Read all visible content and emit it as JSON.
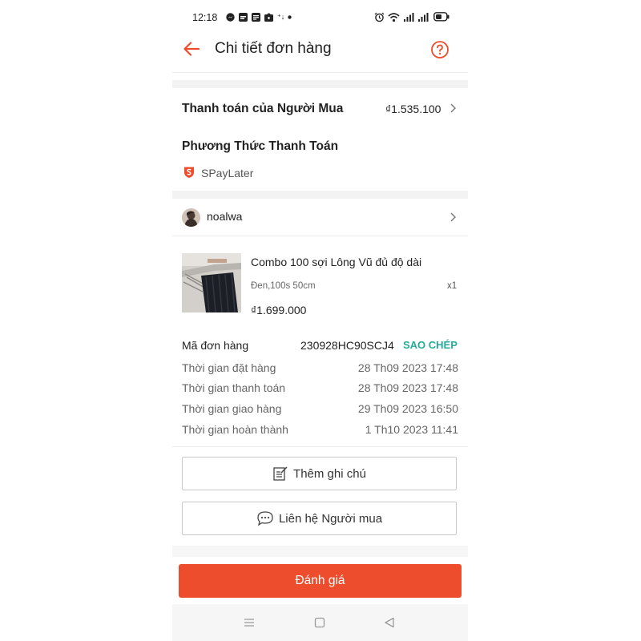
{
  "status_bar": {
    "time": "12:18",
    "icons": [
      "messenger-icon",
      "facebook-icon",
      "facebook-icon",
      "shopee-icon",
      "dot-icon",
      "alarm-icon",
      "wifi-icon",
      "signal-icon",
      "signal-icon",
      "battery-icon"
    ]
  },
  "header": {
    "title": "Chi tiết đơn hàng",
    "back_icon": "arrow-left-icon",
    "help_icon": "question-circle-icon"
  },
  "payment": {
    "buyer_payment_label": "Thanh toán của Người Mua",
    "buyer_payment_amount": "₫1.535.100",
    "method_title": "Phương Thức Thanh Toán",
    "method_name": "SPayLater"
  },
  "buyer": {
    "name": "noalwa"
  },
  "product": {
    "name": "Combo 100 sợi Lông Vũ đủ độ dài",
    "variant": "Đen,100s 50cm",
    "quantity": "x1",
    "price": "₫1.699.000"
  },
  "order_info": {
    "order_id_label": "Mã đơn hàng",
    "order_id": "230928HC90SCJ4",
    "copy_label": "SAO CHÉP",
    "rows": [
      {
        "label": "Thời gian đặt hàng",
        "value": "28 Th09 2023 17:48"
      },
      {
        "label": "Thời gian thanh toán",
        "value": "28 Th09 2023 17:48"
      },
      {
        "label": "Thời gian giao hàng",
        "value": "29 Th09 2023 16:50"
      },
      {
        "label": "Thời gian hoàn thành",
        "value": "1 Th10 2023 11:41"
      }
    ]
  },
  "actions": {
    "add_note_label": "Thêm ghi chú",
    "contact_buyer_label": "Liên hệ Người mua",
    "rate_label": "Đánh giá"
  },
  "colors": {
    "accent": "#ee4d2d",
    "copy_teal": "#26aa99"
  }
}
